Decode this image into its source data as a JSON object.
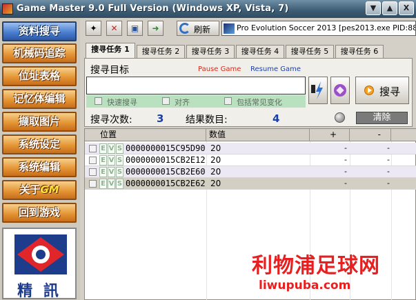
{
  "window": {
    "title": "Game Master 9.0 Full Version (Windows XP, Vista, 7)",
    "buttons": [
      "▼",
      "▲",
      "X"
    ]
  },
  "sidebar": {
    "items": [
      {
        "label": "资料搜寻"
      },
      {
        "label": "机械码追踪"
      },
      {
        "label": "位址表格"
      },
      {
        "label": "记忆体编辑"
      },
      {
        "label": "撷取图片"
      },
      {
        "label": "系统设定"
      },
      {
        "label": "系统编辑"
      },
      {
        "label": "关于",
        "mark": "GM"
      },
      {
        "label": "回到游戏"
      }
    ],
    "logo_text": "精 訊"
  },
  "toolbar": {
    "refresh_label": "刷新",
    "process": "Pro Evolution Soccer 2013  [pes2013.exe PID:880]"
  },
  "tabs": [
    "搜寻任务 1",
    "搜寻任务 2",
    "搜寻任务 3",
    "搜寻任务 4",
    "搜寻任务 5",
    "搜寻任务 6"
  ],
  "search": {
    "target_label": "搜寻目标",
    "pause_label": "Pause Game",
    "resume_label": "Resume Game",
    "input_value": "",
    "options": [
      "快速搜寻",
      "对齐",
      "包括常见变化"
    ],
    "go_label": "搜寻",
    "count_label": "搜寻次数:",
    "count_value": "3",
    "result_label": "结果数目:",
    "result_value": "4",
    "clear_label": "清除"
  },
  "table": {
    "columns": [
      "位置",
      "数值",
      "+",
      "-"
    ],
    "rows": [
      {
        "address": "0000000015C95D90",
        "value": "20",
        "plus": "-",
        "minus": "-"
      },
      {
        "address": "0000000015CB2E12",
        "value": "20",
        "plus": "-",
        "minus": "-"
      },
      {
        "address": "0000000015CB2E60",
        "value": "20",
        "plus": "-",
        "minus": "-"
      },
      {
        "address": "0000000015CB2E62",
        "value": "20",
        "plus": "-",
        "minus": "-"
      }
    ]
  },
  "watermark": {
    "title": "利物浦足球网",
    "url": "liwupuba.com"
  },
  "colors": {
    "sidebar_orange": "#e59636",
    "sidebar_blue": "#4b7fd0",
    "pause_red": "#d62a1a",
    "resume_blue": "#1a3fa8"
  }
}
